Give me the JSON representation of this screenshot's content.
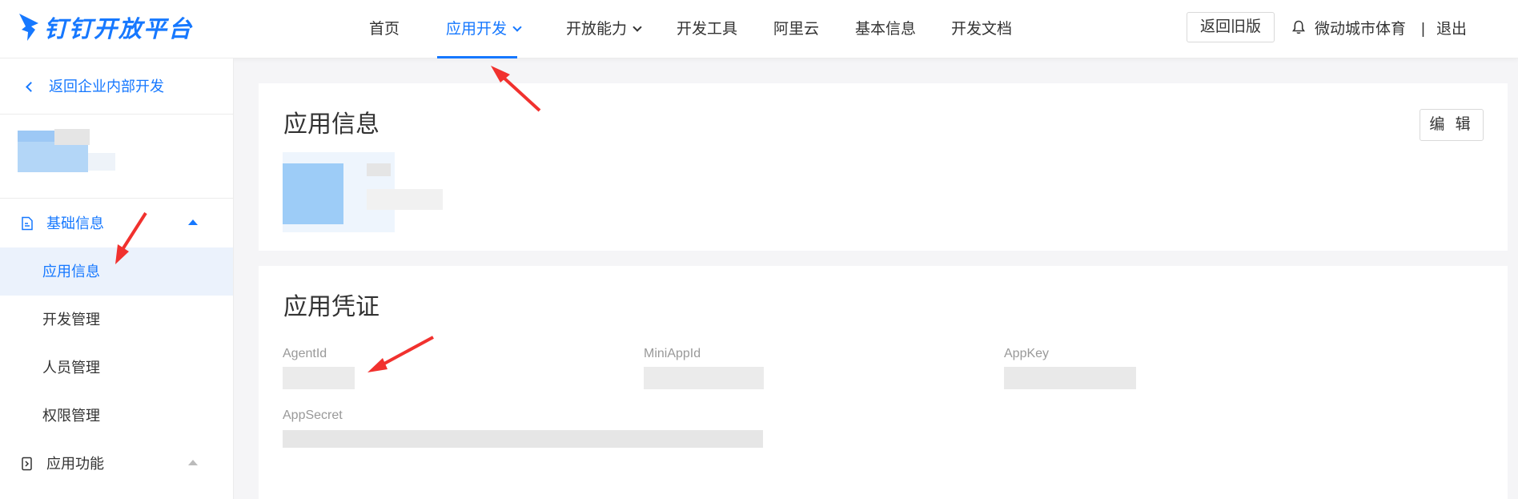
{
  "brand": {
    "name": "钉钉开放平台",
    "color": "#1678ff"
  },
  "nav": {
    "items": [
      {
        "label": "首页",
        "active": false,
        "dropdown": false
      },
      {
        "label": "应用开发",
        "active": true,
        "dropdown": true
      },
      {
        "label": "开放能力",
        "active": false,
        "dropdown": true
      },
      {
        "label": "开发工具",
        "active": false,
        "dropdown": false
      },
      {
        "label": "阿里云",
        "active": false,
        "dropdown": false
      },
      {
        "label": "基本信息",
        "active": false,
        "dropdown": false
      },
      {
        "label": "开发文档",
        "active": false,
        "dropdown": false
      }
    ],
    "old_version_label": "返回旧版",
    "org_name": "微动城市体育",
    "separator": "|",
    "logout_label": "退出"
  },
  "sidebar": {
    "back_label": "返回企业内部开发",
    "groups": [
      {
        "label": "基础信息",
        "icon": "document-icon",
        "expanded": true,
        "items": [
          {
            "label": "应用信息",
            "active": true
          },
          {
            "label": "开发管理",
            "active": false
          },
          {
            "label": "人员管理",
            "active": false
          },
          {
            "label": "权限管理",
            "active": false
          }
        ]
      },
      {
        "label": "应用功能",
        "icon": "app-function-icon",
        "expanded": false,
        "items": []
      }
    ]
  },
  "app_info": {
    "title": "应用信息",
    "edit_label": "编 辑"
  },
  "credentials": {
    "title": "应用凭证",
    "fields": [
      {
        "label": "AgentId"
      },
      {
        "label": "MiniAppId"
      },
      {
        "label": "AppKey"
      },
      {
        "label": "AppSecret"
      }
    ]
  },
  "colors": {
    "accent": "#1678ff",
    "active_bg": "#ebf2fc",
    "annotation_arrow": "#f1312e",
    "page_bg": "#f5f5f7"
  }
}
